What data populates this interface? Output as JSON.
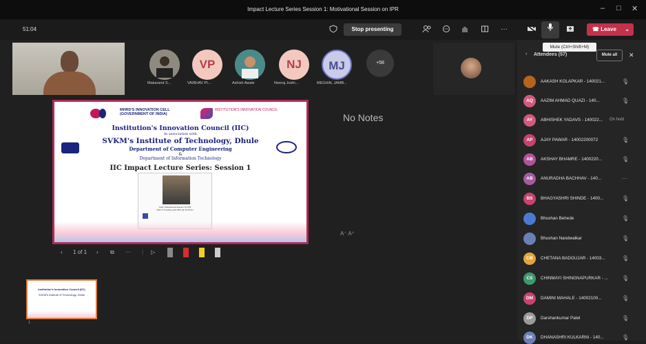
{
  "window": {
    "title": "Impact Lecture Series Session 1: Motivational Session on IPR",
    "minimize": "–",
    "maximize": "□",
    "close": "✕"
  },
  "toolbar": {
    "timer": "51:04",
    "stop_presenting": "Stop presenting",
    "more": "···",
    "leave": "Leave",
    "leave_chevron": "⌄"
  },
  "tooltip": "Mute (Ctrl+Shift+M)",
  "participants": [
    {
      "initials": "",
      "name": "Makarand S...",
      "color": "#bfa58a"
    },
    {
      "initials": "VP",
      "name": "VAIBHAV PI...",
      "color": "#f3c9bf"
    },
    {
      "initials": "",
      "name": "Ashish Awale",
      "color": "#9ab0c4"
    },
    {
      "initials": "NJ",
      "name": "Neeraj Joshi...",
      "color": "#f3c9bf"
    },
    {
      "initials": "MJ",
      "name": "MEGHAL JAMB...",
      "color": "#c9cbe8"
    }
  ],
  "more_participants": "+58",
  "slide": {
    "mhrd": "MHRD'S INNOVATION CELL",
    "mhrd_sub": "(GOVERNMENT OF INDIA)",
    "iic": "INSTITUTION'S INNOVATION COUNCIL",
    "line1": "Institution's Innovation Council (IIC)",
    "line2": "In association with",
    "line3": "SVKM's Institute of Technology, Dhule",
    "line4": "Department of Computer Engineering",
    "line5": "&",
    "line6": "Department of Information Technology",
    "line7": "IIC Impact Lecture Series: Session 1",
    "poster_caption": "Topic: Motivational Session On IPR",
    "poster_date": "Date: 6  Tuesday  April 2021 @ 11:30 am"
  },
  "notes": "No Notes",
  "font_controls": "A⁻  A⁺",
  "slide_nav": {
    "page": "1 of 1"
  },
  "thumbnail": {
    "number": "1",
    "title": "Institution's Innovation Council (IIC)",
    "subtitle": "SVKM's Institute of Technology, Dhule"
  },
  "attendees_panel": {
    "header": "Attendees (57)",
    "mute_all": "Mute all",
    "close": "✕",
    "list": [
      {
        "initials": "",
        "name": "AAKASH KOLAPKAR - 140021...",
        "color": "#b5651d",
        "status": ""
      },
      {
        "initials": "AQ",
        "name": "AAZIM AHMAD QUAZI - 140...",
        "color": "#d25a7e",
        "status": ""
      },
      {
        "initials": "AY",
        "name": "ABHISHEK YADAVS - 140022...",
        "color": "#d25a7e",
        "status": "On hold"
      },
      {
        "initials": "AP",
        "name": "AJAY PAWAR - 14002200072",
        "color": "#c7436e",
        "status": ""
      },
      {
        "initials": "AB",
        "name": "AKSHAY BHAMRE - 1400220...",
        "color": "#b0549a",
        "status": ""
      },
      {
        "initials": "AB",
        "name": "ANURADHA BACHHAV - 140...",
        "color": "#a45ba0",
        "status": ""
      },
      {
        "initials": "BS",
        "name": "BHAGYASHRI SHINDE - 1400...",
        "color": "#c7436e",
        "status": ""
      },
      {
        "initials": "",
        "name": "Bhushan Behede",
        "color": "#4a7bd0",
        "status": ""
      },
      {
        "initials": "",
        "name": "Bhushan Nandwalkar",
        "color": "#6a7fb5",
        "status": ""
      },
      {
        "initials": "CB",
        "name": "CHETANA BADGUJAR - 14003...",
        "color": "#e3a43a",
        "status": ""
      },
      {
        "initials": "CS",
        "name": "CHINMAYI SHINGNAPURKAR - ...",
        "color": "#3c9a6e",
        "status": ""
      },
      {
        "initials": "DM",
        "name": "DAMINI MAHALE - 14002100...",
        "color": "#c7436e",
        "status": ""
      },
      {
        "initials": "DP",
        "name": "Darshankumar Patel",
        "color": "#9a9a9a",
        "status": ""
      },
      {
        "initials": "DK",
        "name": "DHANASHRI KULKARNI - 140...",
        "color": "#6a7fb5",
        "status": ""
      }
    ]
  }
}
